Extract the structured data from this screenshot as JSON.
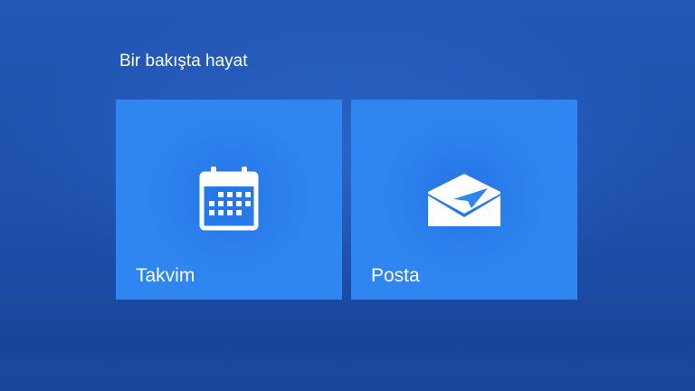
{
  "group": {
    "title": "Bir bakışta hayat"
  },
  "tiles": [
    {
      "label": "Takvim",
      "icon": "calendar-icon"
    },
    {
      "label": "Posta",
      "icon": "mail-icon"
    }
  ],
  "colors": {
    "background": "#1f51ad",
    "tile": "#2f86f0",
    "text": "#ffffff"
  }
}
